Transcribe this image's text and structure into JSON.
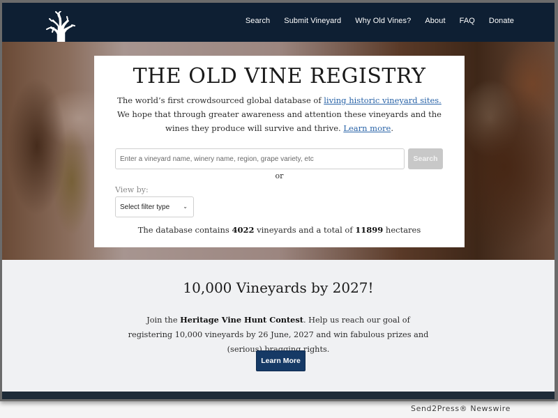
{
  "header": {
    "logo": "vine-tree-logo",
    "nav": [
      {
        "label": "Search"
      },
      {
        "label": "Submit Vineyard"
      },
      {
        "label": "Why Old Vines?"
      },
      {
        "label": "About"
      },
      {
        "label": "FAQ"
      },
      {
        "label": "Donate"
      }
    ]
  },
  "hero": {
    "title": "THE OLD VINE REGISTRY",
    "intro_before": "The world’s first crowdsourced global database of ",
    "intro_link": "living historic vineyard sites.",
    "intro_after": " We hope that through greater awareness and attention these vineyards and the wines they produce will survive and thrive. ",
    "learn_more_link": "Learn more",
    "intro_end": ".",
    "search": {
      "placeholder": "Enter a vineyard name, winery name, region, grape variety, etc",
      "value": "",
      "button_label": "Search"
    },
    "or_text": "or",
    "view_by_label": "View by:",
    "filter": {
      "selected": "Select filter type",
      "icon": "chevron-down-icon"
    },
    "stats": {
      "prefix": "The database contains ",
      "vineyards": "4022",
      "middle": " vineyards and a total of ",
      "hectares": "11899",
      "suffix": " hectares"
    }
  },
  "contest": {
    "title": "10,000 Vineyards by 2027!",
    "text_before": "Join the ",
    "text_bold": "Heritage Vine Hunt Contest",
    "text_after": ". Help us reach our goal of registering 10,000 vineyards by 26 June, 2027 and win fabulous prizes and (serious) bragging rights.",
    "button_label": "Learn More"
  },
  "watermark": "Send2Press® Newswire",
  "colors": {
    "header_bg": "#0e1f33",
    "link": "#2a64a8",
    "primary_button": "#163a66",
    "disabled_button": "#c8c8c8",
    "section_bg": "#f0f1f3"
  }
}
